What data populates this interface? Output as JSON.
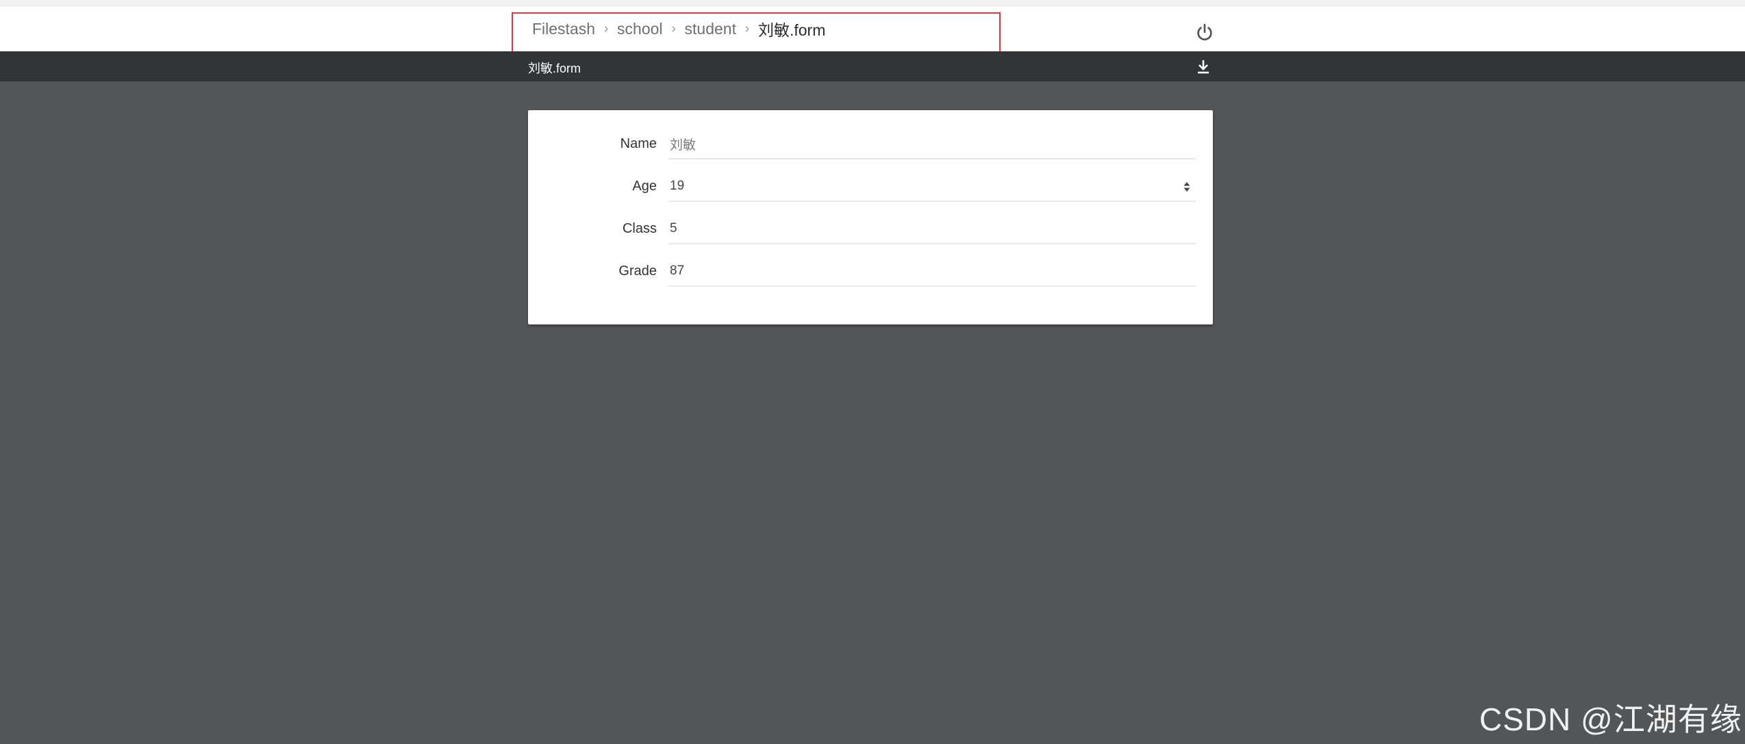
{
  "breadcrumb": {
    "items": [
      {
        "label": "Filestash"
      },
      {
        "label": "school"
      },
      {
        "label": "student"
      },
      {
        "label": "刘敏.form"
      }
    ],
    "separator": "›",
    "highlight_color": "#e0393e"
  },
  "topbar": {
    "power_icon": "power-icon"
  },
  "subbar": {
    "file_title": "刘敏.form",
    "download_icon": "download-icon"
  },
  "form": {
    "fields": [
      {
        "label": "Name",
        "value": "刘敏",
        "type": "text"
      },
      {
        "label": "Age",
        "value": "19",
        "type": "number"
      },
      {
        "label": "Class",
        "value": "5",
        "type": "text"
      },
      {
        "label": "Grade",
        "value": "87",
        "type": "text"
      }
    ]
  },
  "watermark": "CSDN @江湖有缘",
  "colors": {
    "background": "#525659",
    "subbar": "#313538",
    "card": "#ffffff"
  }
}
